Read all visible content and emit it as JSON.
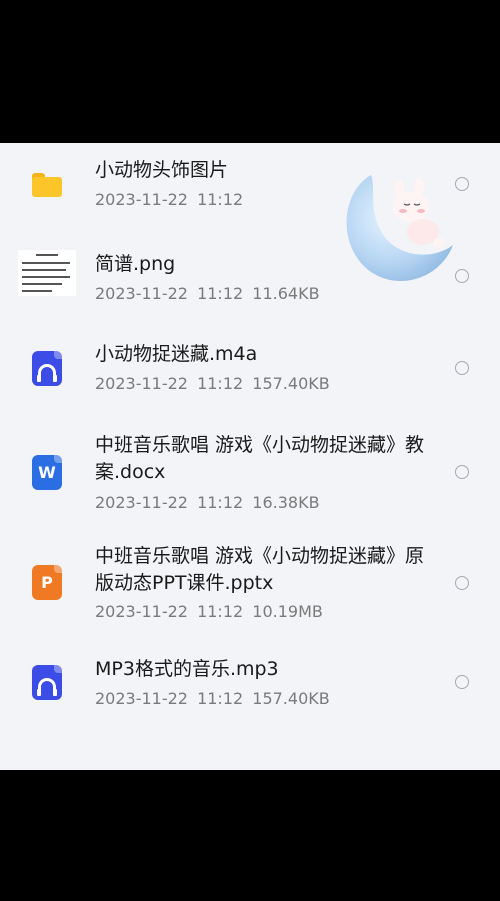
{
  "files": [
    {
      "name": "小动物头饰图片",
      "date": "2023-11-22",
      "time": "11:12",
      "size": "",
      "icon": "folder-icon"
    },
    {
      "name": "简谱.png",
      "date": "2023-11-22",
      "time": "11:12",
      "size": "11.64KB",
      "icon": "image-thumbnail"
    },
    {
      "name": "小动物捉迷藏.m4a",
      "date": "2023-11-22",
      "time": "11:12",
      "size": "157.40KB",
      "icon": "audio-file-icon"
    },
    {
      "name": "中班音乐歌唱 游戏《小动物捉迷藏》教案.docx",
      "date": "2023-11-22",
      "time": "11:12",
      "size": "16.38KB",
      "icon": "word-file-icon"
    },
    {
      "name": "中班音乐歌唱 游戏《小动物捉迷藏》原版动态PPT课件.pptx",
      "date": "2023-11-22",
      "time": "11:12",
      "size": "10.19MB",
      "icon": "ppt-file-icon"
    },
    {
      "name": "MP3格式的音乐.mp3",
      "date": "2023-11-22",
      "time": "11:12",
      "size": "157.40KB",
      "icon": "audio-file-icon"
    }
  ],
  "labels": {
    "word_letter": "W",
    "ppt_letter": "P"
  },
  "meta_lines": [
    "2023-11-22  11:12",
    "2023-11-22  11:12  11.64KB",
    "2023-11-22  11:12  157.40KB",
    "2023-11-22  11:12  16.38KB",
    "2023-11-22  11:12  10.19MB",
    "2023-11-22  11:12  157.40KB"
  ],
  "colors": {
    "folder": "#fcc62a",
    "audio": "#3b4de6",
    "word": "#2b6de3",
    "ppt": "#f07a24"
  }
}
